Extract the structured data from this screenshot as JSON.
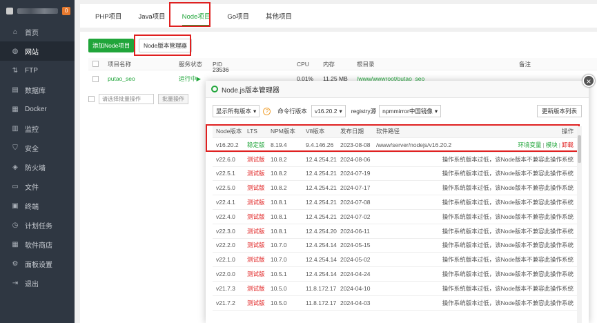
{
  "sidebar": {
    "badge": "0",
    "items": [
      {
        "label": "首页",
        "icon": "home-icon",
        "glyph": "⌂"
      },
      {
        "label": "网站",
        "icon": "globe-icon",
        "glyph": "◍"
      },
      {
        "label": "FTP",
        "icon": "ftp-icon",
        "glyph": "⇅"
      },
      {
        "label": "数据库",
        "icon": "database-icon",
        "glyph": "▤"
      },
      {
        "label": "Docker",
        "icon": "docker-icon",
        "glyph": "▦"
      },
      {
        "label": "监控",
        "icon": "monitor-icon",
        "glyph": "▥"
      },
      {
        "label": "安全",
        "icon": "shield-icon",
        "glyph": "⛉"
      },
      {
        "label": "防火墙",
        "icon": "firewall-icon",
        "glyph": "◈"
      },
      {
        "label": "文件",
        "icon": "folder-icon",
        "glyph": "▭"
      },
      {
        "label": "终端",
        "icon": "terminal-icon",
        "glyph": "▣"
      },
      {
        "label": "计划任务",
        "icon": "clock-icon",
        "glyph": "◷"
      },
      {
        "label": "软件商店",
        "icon": "store-icon",
        "glyph": "▦"
      },
      {
        "label": "面板设置",
        "icon": "gear-icon",
        "glyph": "⚙"
      },
      {
        "label": "退出",
        "icon": "logout-icon",
        "glyph": "⇥"
      }
    ]
  },
  "tabs": [
    "PHP项目",
    "Java项目",
    "Node项目",
    "Go项目",
    "其他项目"
  ],
  "toolbar": {
    "add_node": "添加Node项目",
    "version_manager": "Node版本管理器"
  },
  "project_table": {
    "headers": [
      "项目名称",
      "服务状态",
      "PID",
      "CPU",
      "内存",
      "根目录",
      "备注"
    ],
    "row": {
      "name": "putao_seo",
      "status": "运行中▶",
      "pid": "23536",
      "cpu": "0.01%",
      "mem": "11.25 MB",
      "root": "/www/wwwroot/putao_seo"
    },
    "batch_select": "请选择批量操作",
    "batch_button": "批量操作"
  },
  "modal": {
    "title": "Node.js版本管理器",
    "filter_select": "显示所有版本",
    "cmd_label": "命令行版本",
    "cmd_version": "v16.20.2",
    "registry_label": "registry源",
    "registry_value": "npmmirror中国镜像",
    "refresh": "更新版本列表",
    "headers": [
      "Node版本",
      "LTS",
      "NPM版本",
      "V8版本",
      "发布日期",
      "软件路径",
      "操作"
    ],
    "installed": {
      "version": "v16.20.2",
      "lts": "稳定版",
      "npm": "8.19.4",
      "v8": "9.4.146.26",
      "date": "2023-08-08",
      "path": "/www/server/nodejs/v16.20.2",
      "op1": "环境变量",
      "op2": "模块",
      "op3": "卸载"
    },
    "unsupported_note": "操作系统版本过低，该Node版本不兼容此操作系统",
    "rows": [
      {
        "version": "v22.6.0",
        "lts": "测试版",
        "npm": "10.8.2",
        "v8": "12.4.254.21",
        "date": "2024-08-06"
      },
      {
        "version": "v22.5.1",
        "lts": "测试版",
        "npm": "10.8.2",
        "v8": "12.4.254.21",
        "date": "2024-07-19"
      },
      {
        "version": "v22.5.0",
        "lts": "测试版",
        "npm": "10.8.2",
        "v8": "12.4.254.21",
        "date": "2024-07-17"
      },
      {
        "version": "v22.4.1",
        "lts": "测试版",
        "npm": "10.8.1",
        "v8": "12.4.254.21",
        "date": "2024-07-08"
      },
      {
        "version": "v22.4.0",
        "lts": "测试版",
        "npm": "10.8.1",
        "v8": "12.4.254.21",
        "date": "2024-07-02"
      },
      {
        "version": "v22.3.0",
        "lts": "测试版",
        "npm": "10.8.1",
        "v8": "12.4.254.20",
        "date": "2024-06-11"
      },
      {
        "version": "v22.2.0",
        "lts": "测试版",
        "npm": "10.7.0",
        "v8": "12.4.254.14",
        "date": "2024-05-15"
      },
      {
        "version": "v22.1.0",
        "lts": "测试版",
        "npm": "10.7.0",
        "v8": "12.4.254.14",
        "date": "2024-05-02"
      },
      {
        "version": "v22.0.0",
        "lts": "测试版",
        "npm": "10.5.1",
        "v8": "12.4.254.14",
        "date": "2024-04-24"
      },
      {
        "version": "v21.7.3",
        "lts": "测试版",
        "npm": "10.5.0",
        "v8": "11.8.172.17",
        "date": "2024-04-10"
      },
      {
        "version": "v21.7.2",
        "lts": "测试版",
        "npm": "10.5.0",
        "v8": "11.8.172.17",
        "date": "2024-04-03"
      }
    ]
  }
}
